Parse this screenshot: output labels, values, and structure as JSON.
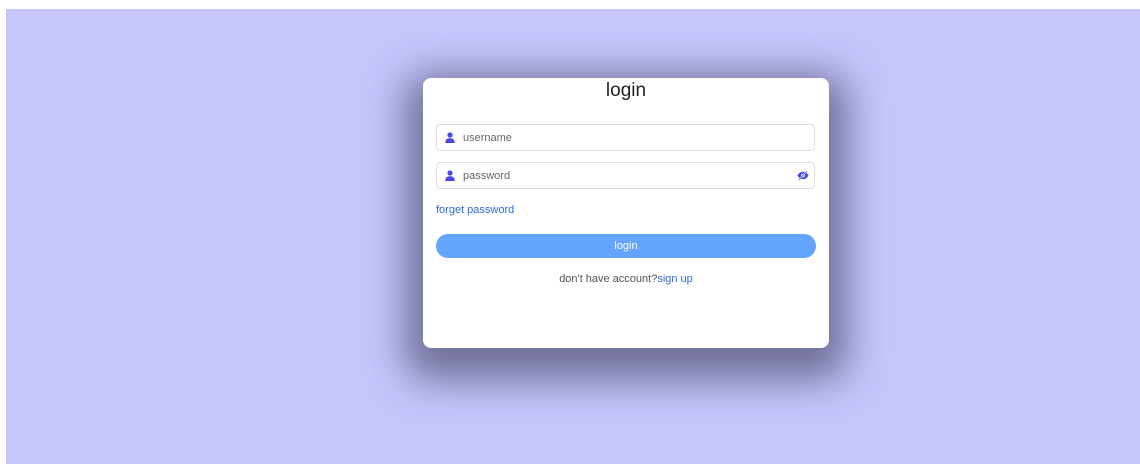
{
  "login_card": {
    "title": "login",
    "username": {
      "placeholder": "username",
      "value": "",
      "icon": "user-icon"
    },
    "password": {
      "placeholder": "password",
      "value": "",
      "icon": "user-icon",
      "toggle_icon": "eye-slash-icon"
    },
    "forget_password_label": "forget password",
    "login_button_label": "login",
    "signup_prompt": "don't have account?",
    "signup_link_label": "sign up"
  },
  "colors": {
    "background": "#c6c6fd",
    "card": "#ffffff",
    "icon": "#4848e8",
    "link": "#2d6bd8",
    "button": "#62a4fe"
  }
}
